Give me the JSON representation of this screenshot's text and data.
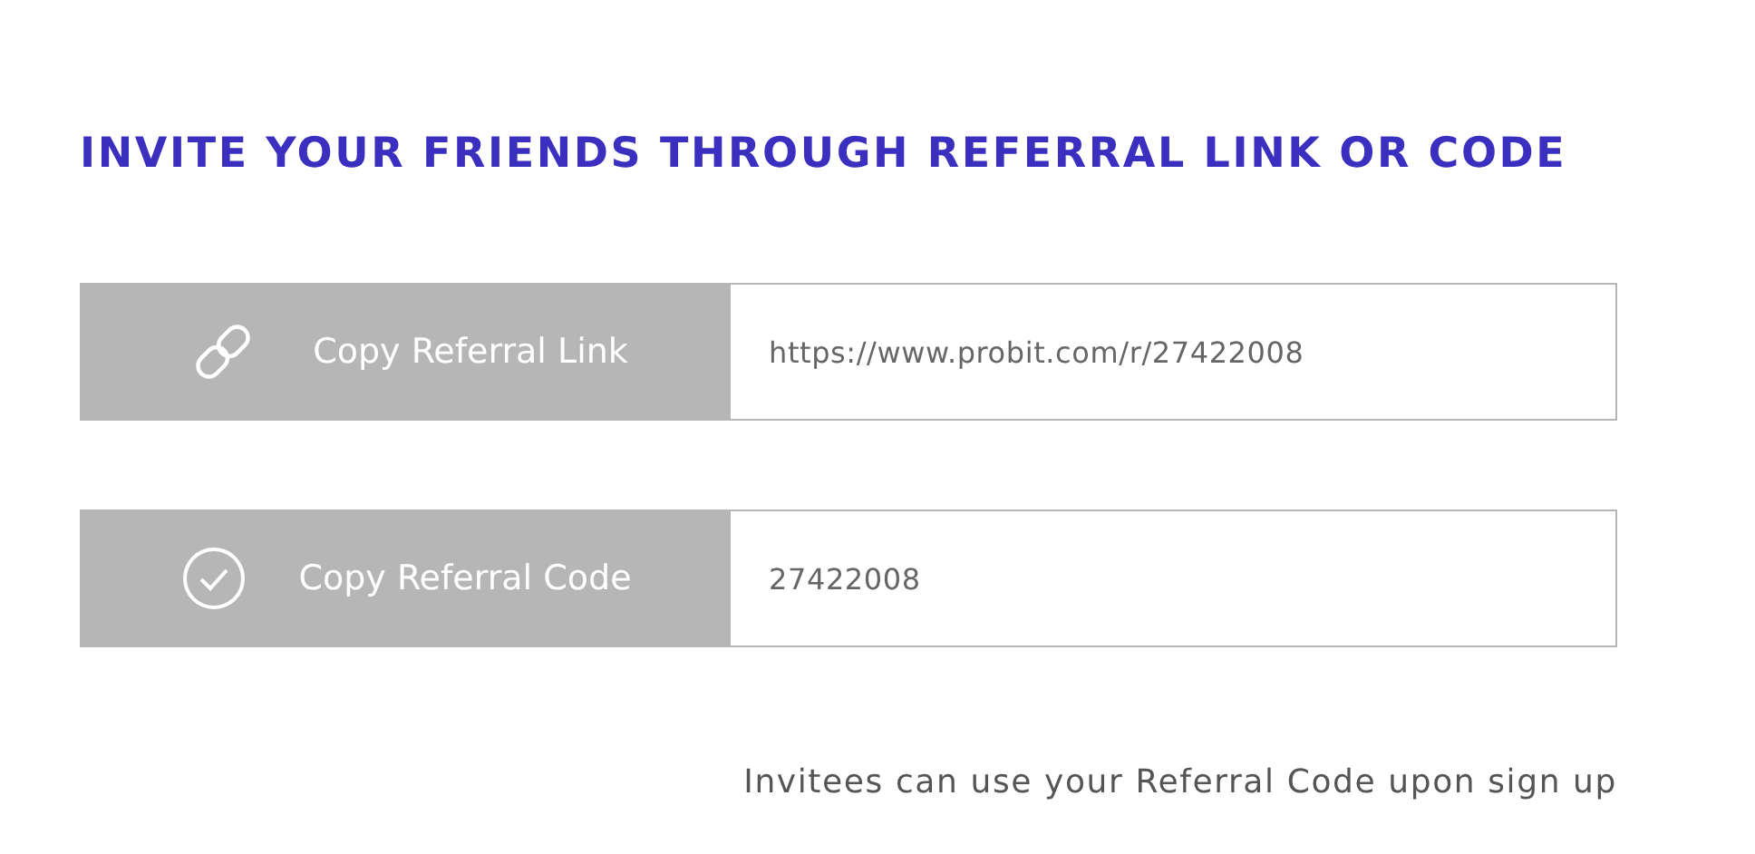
{
  "title": "INVITE YOUR FRIENDS THROUGH REFERRAL LINK OR CODE",
  "rows": [
    {
      "kind": "link",
      "button": "Copy Referral Link",
      "value": "https://www.probit.com/r/27422008"
    },
    {
      "kind": "code",
      "button": "Copy Referral Code",
      "value": "27422008"
    }
  ],
  "note": "Invitees can use your Referral Code upon sign up"
}
